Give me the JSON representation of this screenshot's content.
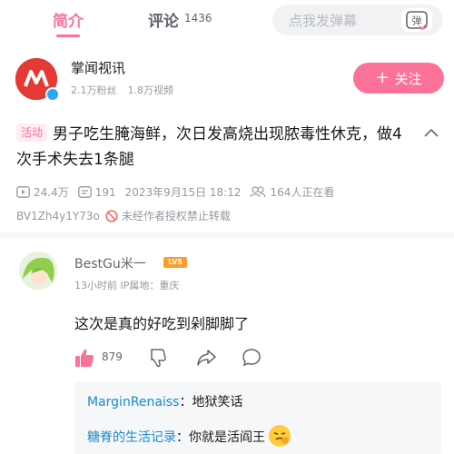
{
  "tabs": {
    "intro_label": "简介",
    "comments_label": "评论",
    "comments_count": "1436"
  },
  "danmaku": {
    "placeholder": "点我发弹幕",
    "icon": "danmaku-toggle-icon",
    "icon_glyph": "弹"
  },
  "uploader": {
    "name": "掌闻视讯",
    "fans": "2.1万粉丝",
    "videos": "1.8万视频",
    "follow_label": "关注",
    "follow_plus": "+"
  },
  "video": {
    "activity_badge": "活动",
    "title": "男子吃生腌海鲜，次日发高烧出现脓毒性休克，做4次手术失去1条腿",
    "views": "24.4万",
    "danmaku_count": "191",
    "date": "2023年9月15日 18:12",
    "watching": "164人正在看",
    "bvid": "BV1Zh4y1Y73o",
    "copyright": "未经作者授权禁止转载"
  },
  "comment": {
    "user": "BestGu米一",
    "level": "LV5",
    "time_location": "13小时前 IP属地：重庆",
    "text": "这次是真的好吃到剁脚脚了",
    "likes": "879",
    "replies": [
      {
        "user": "MarginRenaiss",
        "text": "：地狱笑话"
      },
      {
        "user": "糖脊的生活记录",
        "text": "：你就是活阎王"
      }
    ]
  },
  "colors": {
    "accent": "#fb7299",
    "link": "#178bcf",
    "muted": "#9499a0"
  }
}
